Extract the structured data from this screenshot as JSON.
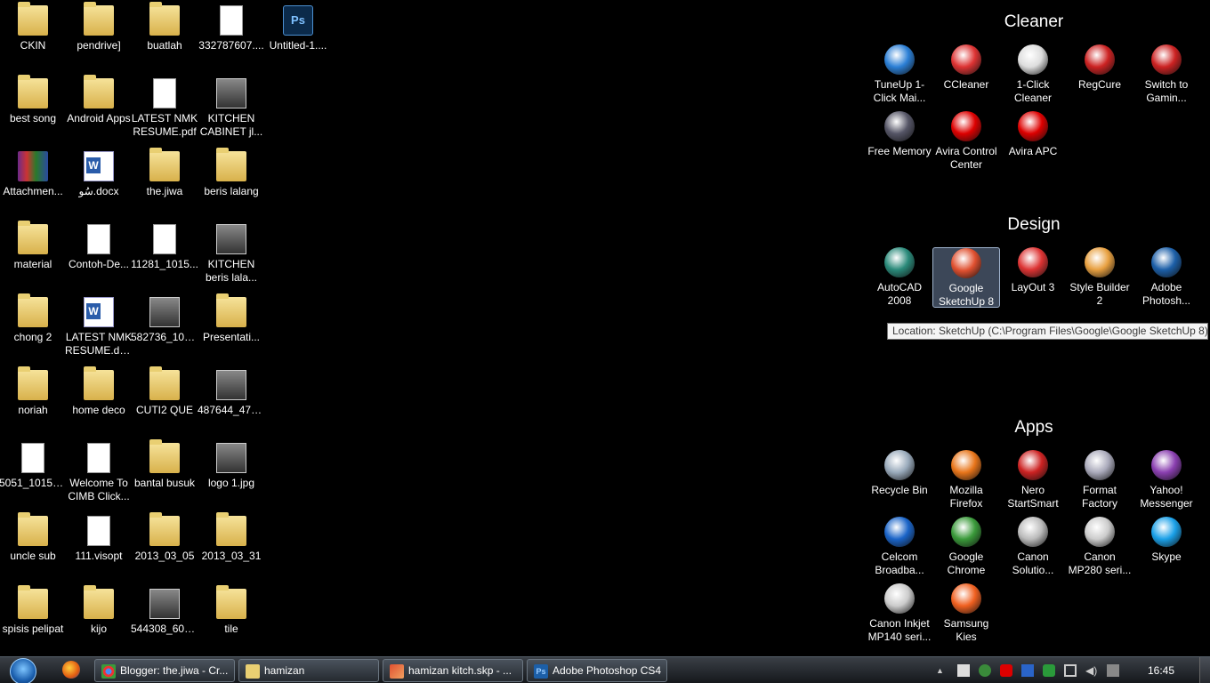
{
  "desktop_icons": [
    {
      "label": "CKIN",
      "type": "folder"
    },
    {
      "label": "pendrive]",
      "type": "folder"
    },
    {
      "label": "buatlah",
      "type": "folder"
    },
    {
      "label": "332787607....",
      "type": "doc"
    },
    {
      "label": "Untitled-1....",
      "type": "ps"
    },
    {
      "label": "best song",
      "type": "folder"
    },
    {
      "label": "Android Apps",
      "type": "folder"
    },
    {
      "label": "LATEST NMK RESUME.pdf",
      "type": "doc"
    },
    {
      "label": "KITCHEN CABINET jl...",
      "type": "img"
    },
    {
      "label": "Attachmen...",
      "type": "rar"
    },
    {
      "label": "ﺳُﻮ.docx",
      "type": "word"
    },
    {
      "label": "the.jiwa",
      "type": "folder"
    },
    {
      "label": "beris lalang",
      "type": "folder"
    },
    {
      "label": "material",
      "type": "folder"
    },
    {
      "label": "Contoh-De...",
      "type": "doc"
    },
    {
      "label": "11281_1015...",
      "type": "doc"
    },
    {
      "label": "KITCHEN beris lala...",
      "type": "img"
    },
    {
      "label": "chong 2",
      "type": "folder"
    },
    {
      "label": "LATEST NMK RESUME.do...",
      "type": "word"
    },
    {
      "label": "582736_101...",
      "type": "img"
    },
    {
      "label": "Presentati...",
      "type": "folder"
    },
    {
      "label": "noriah",
      "type": "folder"
    },
    {
      "label": "home deco",
      "type": "folder"
    },
    {
      "label": "CUTI2 QUE",
      "type": "folder"
    },
    {
      "label": "487644_478...",
      "type": "img"
    },
    {
      "label": "5051_10151...",
      "type": "doc"
    },
    {
      "label": "Welcome To CIMB Click...",
      "type": "doc"
    },
    {
      "label": "bantal busuk",
      "type": "folder"
    },
    {
      "label": "logo 1.jpg",
      "type": "img"
    },
    {
      "label": "uncle sub",
      "type": "folder"
    },
    {
      "label": "111.visopt",
      "type": "doc"
    },
    {
      "label": "2013_03_05",
      "type": "folder"
    },
    {
      "label": "2013_03_31",
      "type": "folder"
    },
    {
      "label": "spisis pelipat",
      "type": "folder"
    },
    {
      "label": "kijo",
      "type": "folder"
    },
    {
      "label": "544308_604...",
      "type": "img"
    },
    {
      "label": "tile",
      "type": "folder"
    }
  ],
  "fences": [
    {
      "title": "Cleaner",
      "items": [
        {
          "label": "TuneUp 1-Click Mai...",
          "color": "#2b7fd6"
        },
        {
          "label": "CCleaner",
          "color": "#d33"
        },
        {
          "label": "1-Click Cleaner",
          "color": "#ddd"
        },
        {
          "label": "RegCure",
          "color": "#c22"
        },
        {
          "label": "Switch to Gamin...",
          "color": "#c22"
        },
        {
          "label": "Free Memory",
          "color": "#556"
        },
        {
          "label": "Avira Control Center",
          "color": "#d00"
        },
        {
          "label": "Avira APC",
          "color": "#d00"
        }
      ]
    },
    {
      "title": "Design",
      "items": [
        {
          "label": "AutoCAD 2008",
          "color": "#2a8a7a"
        },
        {
          "label": "Google SketchUp 8",
          "color": "#e05030",
          "selected": true
        },
        {
          "label": "LayOut 3",
          "color": "#d33"
        },
        {
          "label": "Style Builder 2",
          "color": "#e8a040"
        },
        {
          "label": "Adobe Photosh...",
          "color": "#1c5fa8"
        }
      ]
    },
    {
      "title": "Apps",
      "items": [
        {
          "label": "Recycle Bin",
          "color": "#9ab"
        },
        {
          "label": "Mozilla Firefox",
          "color": "#e8751a"
        },
        {
          "label": "Nero StartSmart",
          "color": "#c22"
        },
        {
          "label": "Format Factory",
          "color": "#aab"
        },
        {
          "label": "Yahoo! Messenger",
          "color": "#8a3fb0"
        },
        {
          "label": "Celcom Broadba...",
          "color": "#1a64c8"
        },
        {
          "label": "Google Chrome",
          "color": "#3a9a3a"
        },
        {
          "label": "Canon Solutio...",
          "color": "#bbb"
        },
        {
          "label": "Canon MP280 seri...",
          "color": "#ccc"
        },
        {
          "label": "Skype",
          "color": "#1aa0e8"
        },
        {
          "label": "Canon Inkjet MP140 seri...",
          "color": "#ccc"
        },
        {
          "label": "Samsung Kies",
          "color": "#f06020"
        }
      ]
    }
  ],
  "tooltip": "Location: SketchUp (C:\\Program Files\\Google\\Google SketchUp 8)",
  "taskbar": {
    "buttons": [
      {
        "label": "Blogger: the.jiwa - Cr...",
        "icon": "chrome-icon"
      },
      {
        "label": "hamizan",
        "icon": "folder-icon"
      },
      {
        "label": "hamizan kitch.skp - ...",
        "icon": "sketchup-icon"
      },
      {
        "label": "Adobe Photoshop CS4",
        "icon": "photoshop-icon"
      }
    ],
    "clock": "16:45"
  }
}
